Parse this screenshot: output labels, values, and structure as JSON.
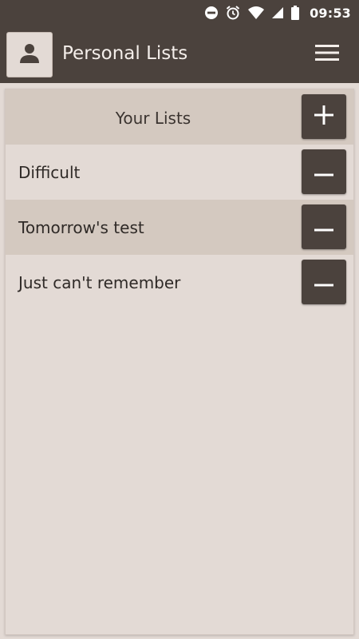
{
  "status_bar": {
    "time": "09:53",
    "icons": [
      "do-not-disturb-icon",
      "alarm-icon",
      "wifi-icon",
      "signal-icon",
      "battery-icon"
    ]
  },
  "app_bar": {
    "title": "Personal Lists",
    "avatar_icon": "person-icon",
    "menu_icon": "hamburger-menu-icon"
  },
  "lists_panel": {
    "title": "Your Lists",
    "add_icon": "plus-icon",
    "items": [
      {
        "label": "Difficult",
        "remove_icon": "minus-icon"
      },
      {
        "label": "Tomorrow's test",
        "remove_icon": "minus-icon"
      },
      {
        "label": "Just can't remember",
        "remove_icon": "minus-icon"
      }
    ]
  },
  "colors": {
    "bar": "#4b423d",
    "background": "#e3dad5",
    "header_row": "#d4c9c0",
    "button": "#4b423d",
    "button_icon": "#ffffff"
  }
}
